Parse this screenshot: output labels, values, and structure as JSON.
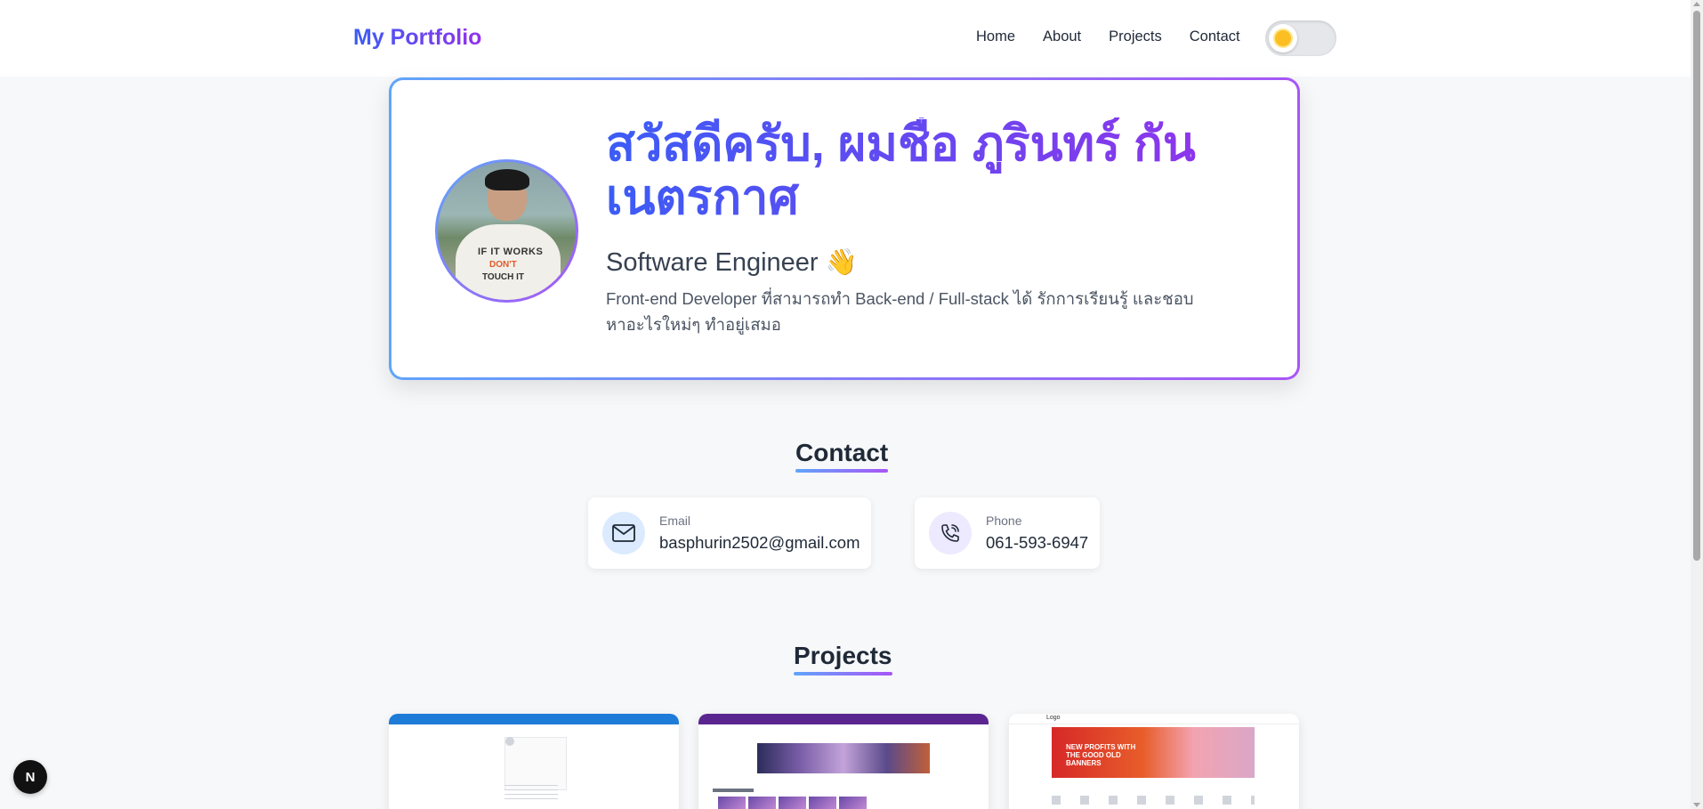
{
  "header": {
    "brand": "My Portfolio",
    "nav": [
      {
        "label": "Home"
      },
      {
        "label": "About"
      },
      {
        "label": "Projects"
      },
      {
        "label": "Contact"
      }
    ],
    "theme_icon": "sun-icon"
  },
  "hero": {
    "title": "สวัสดีครับ, ผมชื่อ ภูรินทร์ กันเนตรกาศ",
    "subtitle": "Software Engineer 👋",
    "description": "Front-end Developer ที่สามารถทำ Back-end / Full-stack ได้ รักการเรียนรู้ และชอบหาอะไรใหม่ๆ ทำอยู่เสมอ",
    "avatar_shirt_lines": [
      "IF IT WORKS",
      "DON'T",
      "TOUCH IT"
    ]
  },
  "contact": {
    "title": "Contact",
    "email": {
      "label": "Email",
      "value": "basphurin2502@gmail.com",
      "icon": "mail-icon"
    },
    "phone": {
      "label": "Phone",
      "value": "061-593-6947",
      "icon": "phone-icon"
    }
  },
  "projects": {
    "title": "Projects",
    "thumbnail_texts": {
      "p3_banner": "NEW PROFITS WITH THE GOOD OLD BANNERS",
      "p3_logo": "Logo"
    }
  },
  "badge": {
    "label": "N"
  },
  "colors": {
    "gradient_start": "#3b5cf6",
    "gradient_end": "#9333ea",
    "text": "#1f2937"
  }
}
